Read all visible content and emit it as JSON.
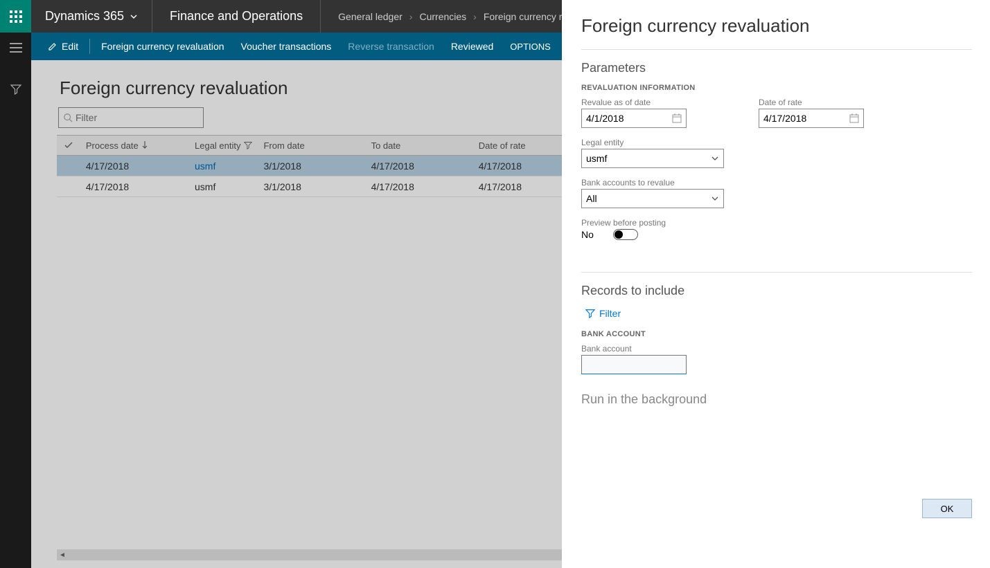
{
  "topbar": {
    "brand": "Dynamics 365",
    "module": "Finance and Operations",
    "breadcrumbs": [
      "General ledger",
      "Currencies",
      "Foreign currency r"
    ]
  },
  "actionbar": {
    "edit": "Edit",
    "fcr": "Foreign currency revaluation",
    "voucher": "Voucher transactions",
    "reverse": "Reverse transaction",
    "reviewed": "Reviewed",
    "options": "OPTIONS"
  },
  "page": {
    "title": "Foreign currency revaluation",
    "filter_placeholder": "Filter"
  },
  "grid": {
    "headers": {
      "process_date": "Process date",
      "legal_entity": "Legal entity",
      "from_date": "From date",
      "to_date": "To date",
      "date_of_rate": "Date of rate"
    },
    "rows": [
      {
        "process_date": "4/17/2018",
        "legal_entity": "usmf",
        "from_date": "3/1/2018",
        "to_date": "4/17/2018",
        "date_of_rate": "4/17/2018",
        "selected": true,
        "link": true
      },
      {
        "process_date": "4/17/2018",
        "legal_entity": "usmf",
        "from_date": "3/1/2018",
        "to_date": "4/17/2018",
        "date_of_rate": "4/17/2018",
        "selected": false,
        "link": false
      }
    ]
  },
  "panel": {
    "title": "Foreign currency revaluation",
    "parameters": "Parameters",
    "reval_info": "REVALUATION INFORMATION",
    "revalue_as_of": {
      "label": "Revalue as of date",
      "value": "4/1/2018"
    },
    "date_of_rate": {
      "label": "Date of rate",
      "value": "4/17/2018"
    },
    "legal_entity": {
      "label": "Legal entity",
      "value": "usmf"
    },
    "bank_accounts": {
      "label": "Bank accounts to revalue",
      "value": "All"
    },
    "preview": {
      "label": "Preview before posting",
      "value": "No"
    },
    "records_to_include": "Records to include",
    "filter": "Filter",
    "bank_account_group": "BANK ACCOUNT",
    "bank_account_label": "Bank account",
    "run_bg": "Run in the background",
    "ok": "OK"
  }
}
